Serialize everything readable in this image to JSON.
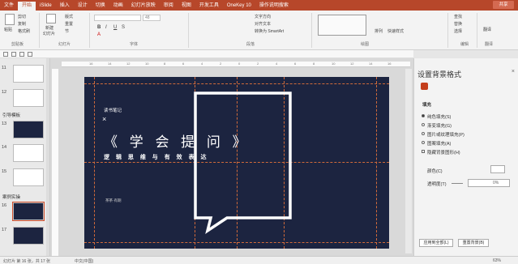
{
  "tabs": [
    "文件",
    "开始",
    "iSlide",
    "插入",
    "设计",
    "切换",
    "动画",
    "幻灯片放映",
    "审阅",
    "视图",
    "开发工具",
    "OneKey 10",
    "操作说明搜索"
  ],
  "active_tab": "开始",
  "share": "共享",
  "ribbon": {
    "paste": "粘贴",
    "cut": "剪切",
    "copy": "复制",
    "format_painter": "格式刷",
    "clipboard": "剪贴板",
    "new_slide": "新建",
    "new_slide2": "幻灯片",
    "layout": "版式",
    "reset": "重置",
    "section": "节",
    "slides": "幻灯片",
    "font_size": "48",
    "font": "字体",
    "text_direction": "文字方向",
    "align_text": "对齐文本",
    "smartart": "转换为 SmartArt",
    "paragraph": "段落",
    "drawing": "绘图",
    "arrange": "排列",
    "quick_styles": "快速样式",
    "find": "查找",
    "replace": "替换",
    "select": "选择",
    "editing": "编辑",
    "translate": "翻译",
    "translate_group": "翻译"
  },
  "thumbs": {
    "n11": "11",
    "n12": "12",
    "n13": "13",
    "n14": "14",
    "n15": "15",
    "n16": "16",
    "n17": "17",
    "section1": "引导模板",
    "section2": "案例实操"
  },
  "ruler": [
    "16",
    "14",
    "12",
    "10",
    "8",
    "6",
    "4",
    "2",
    "0",
    "2",
    "4",
    "6",
    "8",
    "10",
    "12",
    "14",
    "16"
  ],
  "slide": {
    "notes_label": "读书笔记",
    "close_mark": "×",
    "title": "《 学 会 提 问 》",
    "subtitle": "逻 辑 思 维 与 有 效 表 达",
    "author": "茶茶·有期"
  },
  "pane": {
    "title": "设置背景格式",
    "close": "×",
    "section": "填充",
    "options": [
      "纯色填充(S)",
      "渐变填充(G)",
      "图片或纹理填充(P)",
      "图案填充(A)",
      "隐藏背景图形(H)"
    ],
    "color": "颜色(C)",
    "transparency": "透明度(T)",
    "transparency_value": "0%",
    "apply_all": "应用到全部(L)",
    "reset_bg": "重置背景(B)"
  },
  "status": {
    "slide_info": "幻灯片 第 16 张，共 17 张",
    "language": "中文(中国)",
    "zoom": "63%"
  },
  "colors": {
    "brand": "#b7472a",
    "slide_bg": "#1c2440",
    "guide": "#d06a3a"
  }
}
